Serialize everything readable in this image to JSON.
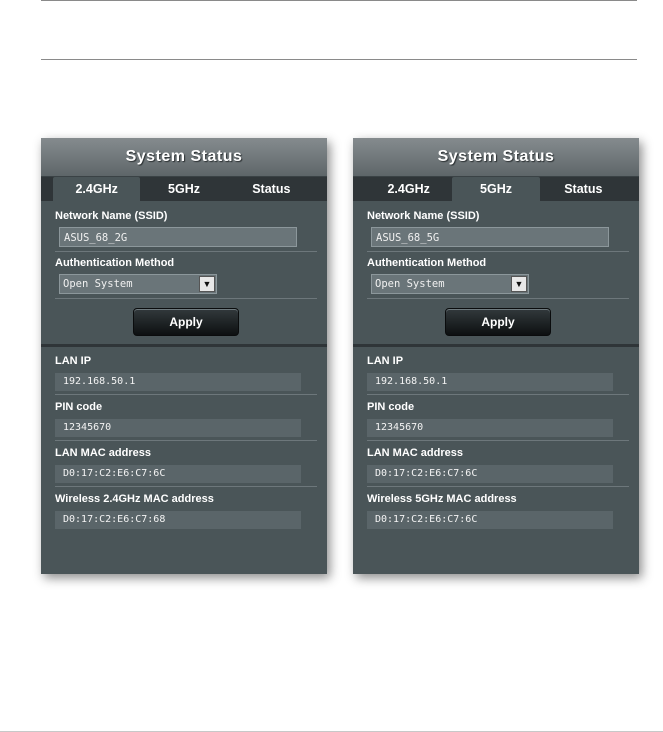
{
  "panels": [
    {
      "title": "System Status",
      "tabs": [
        "2.4GHz",
        "5GHz",
        "Status"
      ],
      "active_tab": 0,
      "ssid_label": "Network Name (SSID)",
      "ssid_value": "ASUS_68_2G",
      "auth_label": "Authentication Method",
      "auth_value": "Open System",
      "apply_label": "Apply",
      "lan_ip_label": "LAN IP",
      "lan_ip_value": "192.168.50.1",
      "pin_label": "PIN code",
      "pin_value": "12345670",
      "lan_mac_label": "LAN MAC address",
      "lan_mac_value": "D0:17:C2:E6:C7:6C",
      "wireless_mac_label": "Wireless 2.4GHz MAC address",
      "wireless_mac_value": "D0:17:C2:E6:C7:68"
    },
    {
      "title": "System Status",
      "tabs": [
        "2.4GHz",
        "5GHz",
        "Status"
      ],
      "active_tab": 1,
      "ssid_label": "Network Name (SSID)",
      "ssid_value": "ASUS_68_5G",
      "auth_label": "Authentication Method",
      "auth_value": "Open System",
      "apply_label": "Apply",
      "lan_ip_label": "LAN IP",
      "lan_ip_value": "192.168.50.1",
      "pin_label": "PIN code",
      "pin_value": "12345670",
      "lan_mac_label": "LAN MAC address",
      "lan_mac_value": "D0:17:C2:E6:C7:6C",
      "wireless_mac_label": "Wireless 5GHz MAC address",
      "wireless_mac_value": "D0:17:C2:E6:C7:6C"
    }
  ]
}
